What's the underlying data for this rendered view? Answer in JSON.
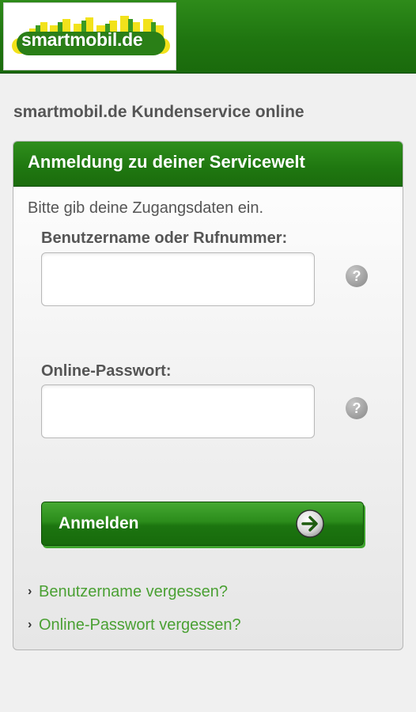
{
  "header": {
    "logo_text": "smartmobil.de",
    "colors": {
      "bar": "#1f7510",
      "logo_yellow": "#f2e21b",
      "logo_green": "#2f8e1c"
    }
  },
  "page": {
    "title": "smartmobil.de Kundenservice online"
  },
  "login_card": {
    "title": "Anmeldung zu deiner Servicewelt",
    "intro": "Bitte gib deine Zugangsdaten ein.",
    "username": {
      "label": "Benutzername oder Rufnummer:",
      "value": "",
      "placeholder": "",
      "help_icon": "question-mark-icon",
      "help_glyph": "?"
    },
    "password": {
      "label": "Online-Passwort:",
      "value": "",
      "placeholder": "",
      "help_icon": "question-mark-icon",
      "help_glyph": "?"
    },
    "submit": {
      "label": "Anmelden",
      "icon": "arrow-right-icon"
    },
    "links": [
      {
        "label": "Benutzername vergessen?",
        "icon": "chevron-right-icon",
        "glyph": "›"
      },
      {
        "label": "Online-Passwort vergessen?",
        "icon": "chevron-right-icon",
        "glyph": "›"
      }
    ],
    "accent_color": "#4aa033"
  }
}
